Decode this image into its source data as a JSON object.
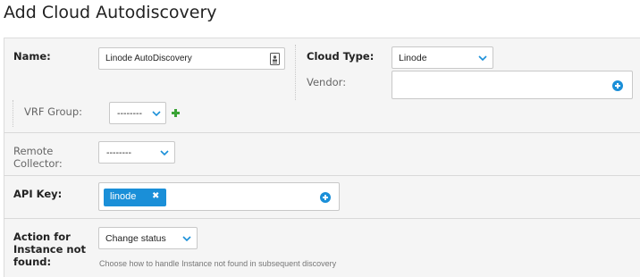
{
  "page": {
    "title": "Add Cloud Autodiscovery"
  },
  "form": {
    "name": {
      "label": "Name:",
      "value": "Linode AutoDiscovery"
    },
    "cloud_type": {
      "label": "Cloud Type:",
      "value": "Linode"
    },
    "vendor": {
      "label": "Vendor:",
      "value": ""
    },
    "vrf_group": {
      "label": "VRF Group:",
      "value": "--------"
    },
    "remote_collector": {
      "label_line1": "Remote",
      "label_line2": "Collector:",
      "value": "--------"
    },
    "api_key": {
      "label": "API Key:",
      "tag": "linode",
      "tag_remove": "✖"
    },
    "action": {
      "label_line1": "Action for",
      "label_line2": "Instance not",
      "label_line3": "found:",
      "value": "Change status",
      "help": "Choose how to handle Instance not found in subsequent discovery"
    }
  },
  "colors": {
    "accent": "#1a8fd8",
    "add_green": "#3aa335"
  },
  "icons": {
    "name_field": "contact-card-icon",
    "dropdown": "chevron-down-icon",
    "add_vendor": "plus-circle-icon",
    "add_vrf": "green-plus-icon",
    "add_api_key": "plus-circle-icon",
    "tag_remove": "close-icon"
  }
}
